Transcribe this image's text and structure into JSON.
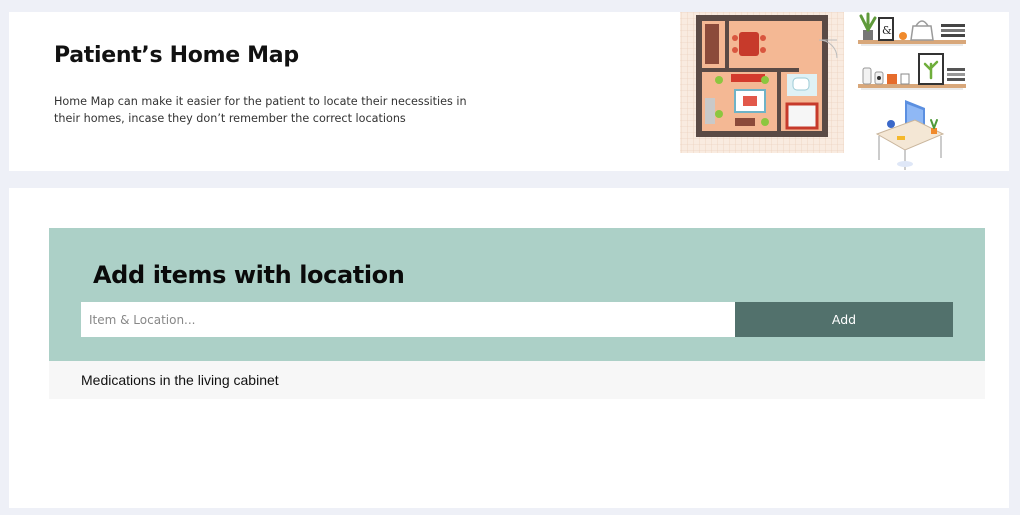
{
  "header": {
    "title": "Patient’s Home Map",
    "description": "Home Map can make it easier for the patient to locate their necessities in their homes, incase they don’t remember the correct locations"
  },
  "add_section": {
    "heading": "Add items with location",
    "input_placeholder": "Item & Location...",
    "input_value": "",
    "button_label": "Add"
  },
  "items": [
    {
      "label": "Medications in the living cabinet"
    }
  ],
  "colors": {
    "page_background": "#eef0f7",
    "panel": "#acd0c7",
    "button": "#52716c",
    "list_item_background": "#f7f7f7"
  },
  "illustration": {
    "icons": [
      "floor-plan-icon",
      "kitchen-shelves-icon",
      "home-office-desk-icon"
    ]
  }
}
